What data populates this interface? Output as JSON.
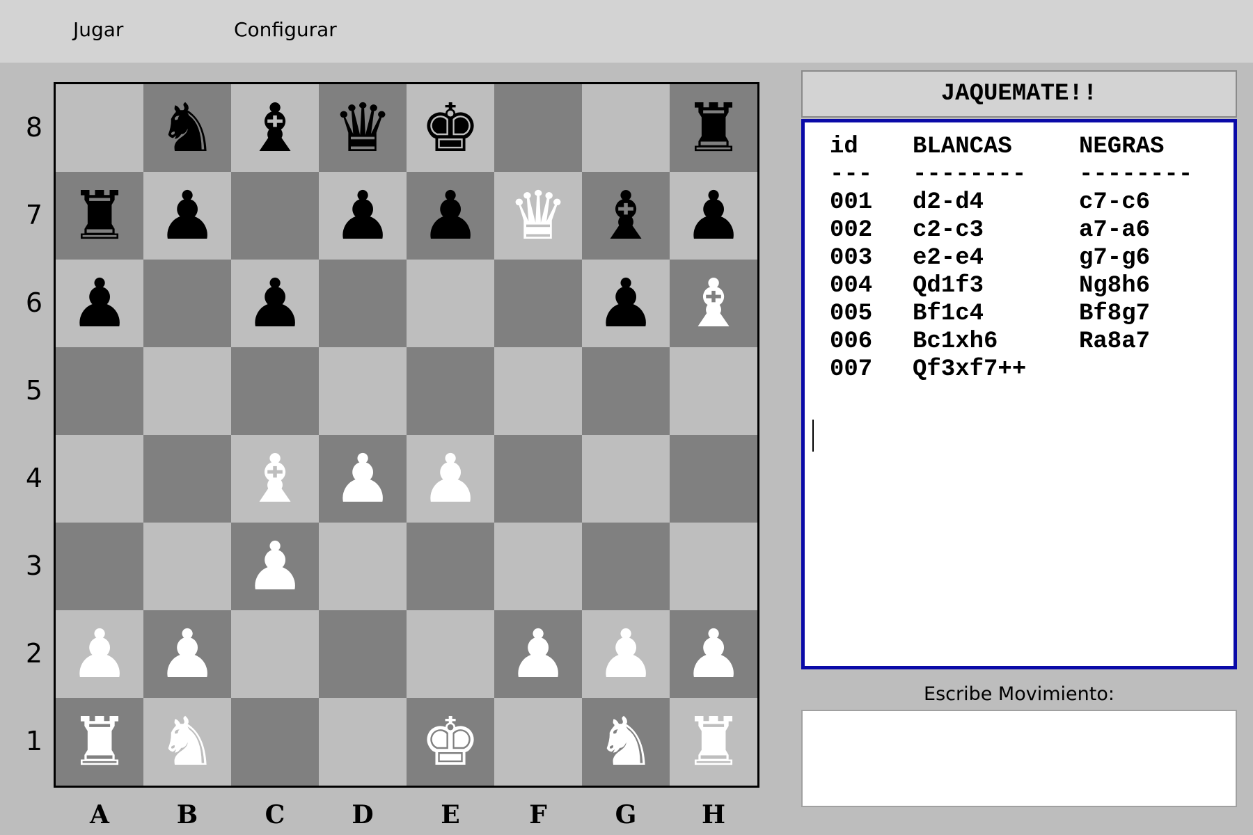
{
  "menu": {
    "play": "Jugar",
    "configure": "Configurar"
  },
  "board": {
    "files": [
      "A",
      "B",
      "C",
      "D",
      "E",
      "F",
      "G",
      "H"
    ],
    "ranks": [
      "8",
      "7",
      "6",
      "5",
      "4",
      "3",
      "2",
      "1"
    ],
    "pieces": [
      {
        "square": "b8",
        "glyph": "♞",
        "color": "black",
        "name": "knight"
      },
      {
        "square": "c8",
        "glyph": "♝",
        "color": "black",
        "name": "bishop"
      },
      {
        "square": "d8",
        "glyph": "♛",
        "color": "black",
        "name": "queen"
      },
      {
        "square": "e8",
        "glyph": "♚",
        "color": "black",
        "name": "king"
      },
      {
        "square": "h8",
        "glyph": "♜",
        "color": "black",
        "name": "rook"
      },
      {
        "square": "a7",
        "glyph": "♜",
        "color": "black",
        "name": "rook"
      },
      {
        "square": "b7",
        "glyph": "♟",
        "color": "black",
        "name": "pawn"
      },
      {
        "square": "d7",
        "glyph": "♟",
        "color": "black",
        "name": "pawn"
      },
      {
        "square": "e7",
        "glyph": "♟",
        "color": "black",
        "name": "pawn"
      },
      {
        "square": "f7",
        "glyph": "♛",
        "color": "white",
        "name": "queen"
      },
      {
        "square": "g7",
        "glyph": "♝",
        "color": "black",
        "name": "bishop"
      },
      {
        "square": "h7",
        "glyph": "♟",
        "color": "black",
        "name": "pawn"
      },
      {
        "square": "a6",
        "glyph": "♟",
        "color": "black",
        "name": "pawn"
      },
      {
        "square": "c6",
        "glyph": "♟",
        "color": "black",
        "name": "pawn"
      },
      {
        "square": "g6",
        "glyph": "♟",
        "color": "black",
        "name": "pawn"
      },
      {
        "square": "h6",
        "glyph": "♝",
        "color": "white",
        "name": "bishop"
      },
      {
        "square": "c4",
        "glyph": "♝",
        "color": "white",
        "name": "bishop"
      },
      {
        "square": "d4",
        "glyph": "♟",
        "color": "white",
        "name": "pawn"
      },
      {
        "square": "e4",
        "glyph": "♟",
        "color": "white",
        "name": "pawn"
      },
      {
        "square": "c3",
        "glyph": "♟",
        "color": "white",
        "name": "pawn"
      },
      {
        "square": "a2",
        "glyph": "♟",
        "color": "white",
        "name": "pawn"
      },
      {
        "square": "b2",
        "glyph": "♟",
        "color": "white",
        "name": "pawn"
      },
      {
        "square": "f2",
        "glyph": "♟",
        "color": "white",
        "name": "pawn"
      },
      {
        "square": "g2",
        "glyph": "♟",
        "color": "white",
        "name": "pawn"
      },
      {
        "square": "h2",
        "glyph": "♟",
        "color": "white",
        "name": "pawn"
      },
      {
        "square": "a1",
        "glyph": "♜",
        "color": "white",
        "name": "rook"
      },
      {
        "square": "b1",
        "glyph": "♞",
        "color": "white",
        "name": "knight"
      },
      {
        "square": "e1",
        "glyph": "♚",
        "color": "white",
        "name": "king"
      },
      {
        "square": "g1",
        "glyph": "♞",
        "color": "white",
        "name": "knight"
      },
      {
        "square": "h1",
        "glyph": "♜",
        "color": "white",
        "name": "rook"
      }
    ]
  },
  "status": "JAQUEMATE!!",
  "log": {
    "header": {
      "id": "id",
      "white": "BLANCAS",
      "black": "NEGRAS"
    },
    "separator": {
      "id": "---",
      "white": "--------",
      "black": "--------"
    },
    "moves": [
      {
        "id": "001",
        "white": "d2-d4",
        "black": "c7-c6"
      },
      {
        "id": "002",
        "white": "c2-c3",
        "black": "a7-a6"
      },
      {
        "id": "003",
        "white": "e2-e4",
        "black": "g7-g6"
      },
      {
        "id": "004",
        "white": "Qd1f3",
        "black": "Ng8h6"
      },
      {
        "id": "005",
        "white": "Bf1c4",
        "black": "Bf8g7"
      },
      {
        "id": "006",
        "white": "Bc1xh6",
        "black": "Ra8a7"
      },
      {
        "id": "007",
        "white": "Qf3xf7++",
        "black": ""
      }
    ]
  },
  "move_input": {
    "label": "Escribe Movimiento:",
    "value": ""
  }
}
